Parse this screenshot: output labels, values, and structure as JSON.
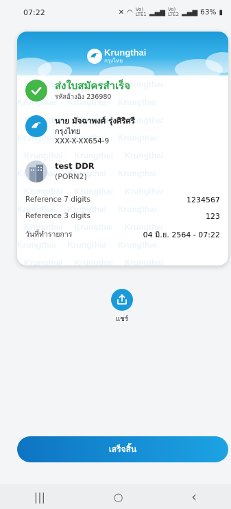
{
  "status_bar": {
    "time": "07:22",
    "signal_top": "Vo)",
    "signal_bottom": "LTE1",
    "signal2_top": "Vo)",
    "signal2_bottom": "LTE2",
    "battery": "63%"
  },
  "card": {
    "logo": {
      "name": "Krungthai",
      "name_th": "กรุงไทย"
    },
    "watermark_text": "Krungthai",
    "status": {
      "title": "ส่งใบสมัครสำเร็จ",
      "reference": "รหัสอ้างอิง 236980"
    },
    "from": {
      "name": "นาย มัจฉาพงศ์ รุ่งศิริศรี",
      "bank": "กรุงไทย",
      "account": "XXX-X-XX654-9"
    },
    "to": {
      "name": "test DDR",
      "code": "(PORN2)"
    },
    "details": [
      {
        "label": "Reference 7 digits",
        "value": "1234567"
      },
      {
        "label": "Reference 3 digits",
        "value": "123"
      },
      {
        "label": "วันที่ทำรายการ",
        "value": "04 มิ.ย. 2564 - 07:22"
      }
    ]
  },
  "share": {
    "label": "แชร์"
  },
  "done_button": {
    "label": "เสร็จสิ้น"
  },
  "nav": {
    "recents": "|||",
    "home": "○",
    "back": "‹"
  },
  "colors": {
    "accent": "#1b9ad9",
    "success": "#45b649"
  }
}
